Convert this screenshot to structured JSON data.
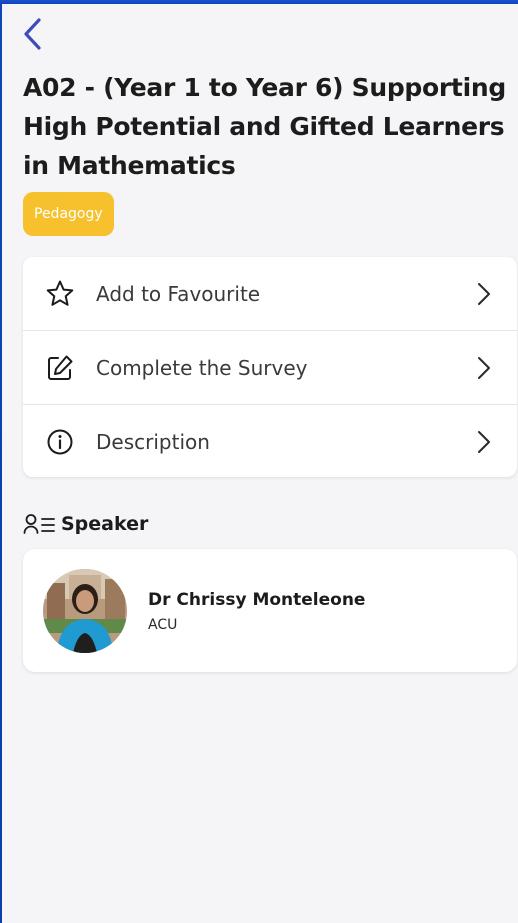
{
  "header": {
    "back_icon": "chevron-left-icon",
    "accent_color": "#3b4db8"
  },
  "session": {
    "title": "A02 - (Year 1 to Year 6) Supporting High Potential and Gifted Learners in Mathematics",
    "tag": "Pedagogy",
    "tag_color": "#f7c12d"
  },
  "menu": {
    "items": [
      {
        "label": "Add to Favourite",
        "icon": "star-outline-icon"
      },
      {
        "label": "Complete the Survey",
        "icon": "edit-square-icon"
      },
      {
        "label": "Description",
        "icon": "info-circle-icon"
      }
    ]
  },
  "speaker_section": {
    "heading": "Speaker",
    "icon": "person-list-icon",
    "speakers": [
      {
        "name": "Dr Chrissy Monteleone",
        "organisation": "ACU"
      }
    ]
  }
}
